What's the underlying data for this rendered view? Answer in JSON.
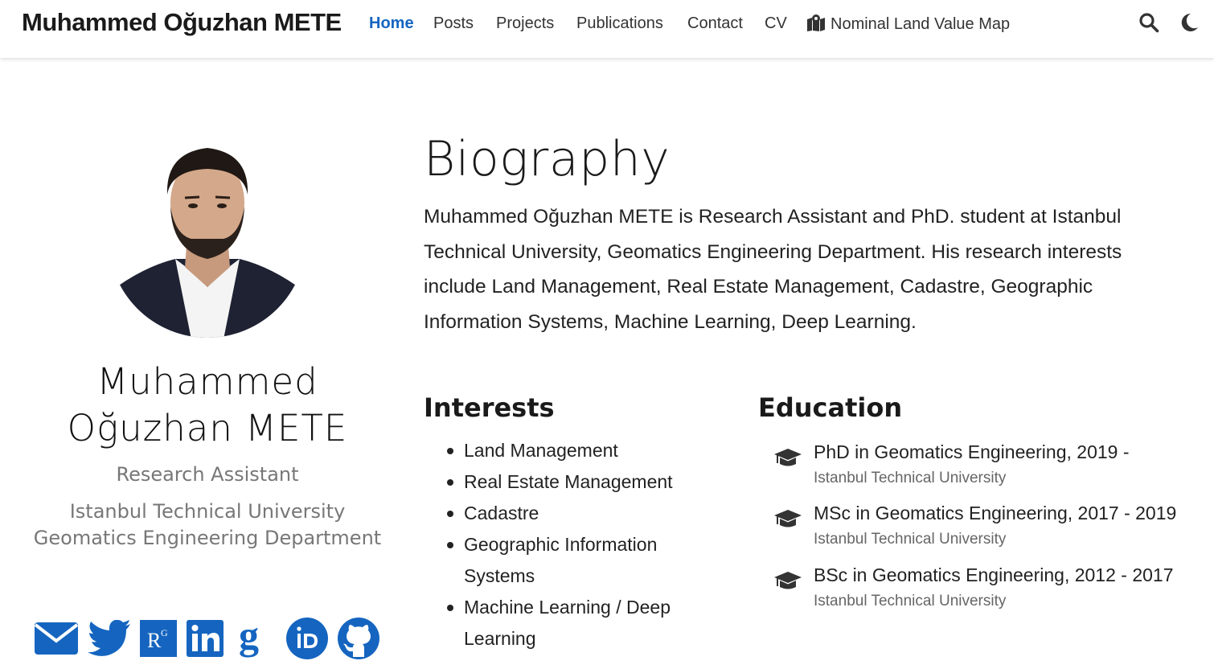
{
  "navbar": {
    "brand": "Muhammed Oğuzhan METE",
    "links": [
      "Home",
      "Posts",
      "Projects",
      "Publications",
      "Contact",
      "CV"
    ],
    "map_link": "Nominal Land Value Map",
    "active": "Home",
    "accent_color": "#1565c0"
  },
  "profile": {
    "name": "Muhammed Oğuzhan METE",
    "role": "Research Assistant",
    "org": "Istanbul Technical University Geomatics Engineering Department",
    "social": [
      "email-icon",
      "twitter-icon",
      "researchgate-icon",
      "linkedin-icon",
      "google-scholar-icon",
      "orcid-icon",
      "github-icon"
    ],
    "social_color": "#1565c0"
  },
  "biography": {
    "title": "Biography",
    "text": "Muhammed Oğuzhan METE is Research Assistant and PhD. student at Istanbul Technical University, Geomatics Engineering Department. His research interests include Land Management, Real Estate Management, Cadastre, Geographic Information Systems, Machine Learning, Deep Learning."
  },
  "interests": {
    "title": "Interests",
    "items": [
      "Land Management",
      "Real Estate Management",
      "Cadastre",
      "Geographic Information Systems",
      "Machine Learning / Deep Learning"
    ]
  },
  "education": {
    "title": "Education",
    "items": [
      {
        "degree": "PhD in Geomatics Engineering, 2019 -",
        "institution": "Istanbul Technical University"
      },
      {
        "degree": "MSc in Geomatics Engineering, 2017 - 2019",
        "institution": "Istanbul Technical University"
      },
      {
        "degree": "BSc in Geomatics Engineering, 2012 - 2017",
        "institution": "Istanbul Technical University"
      }
    ]
  }
}
